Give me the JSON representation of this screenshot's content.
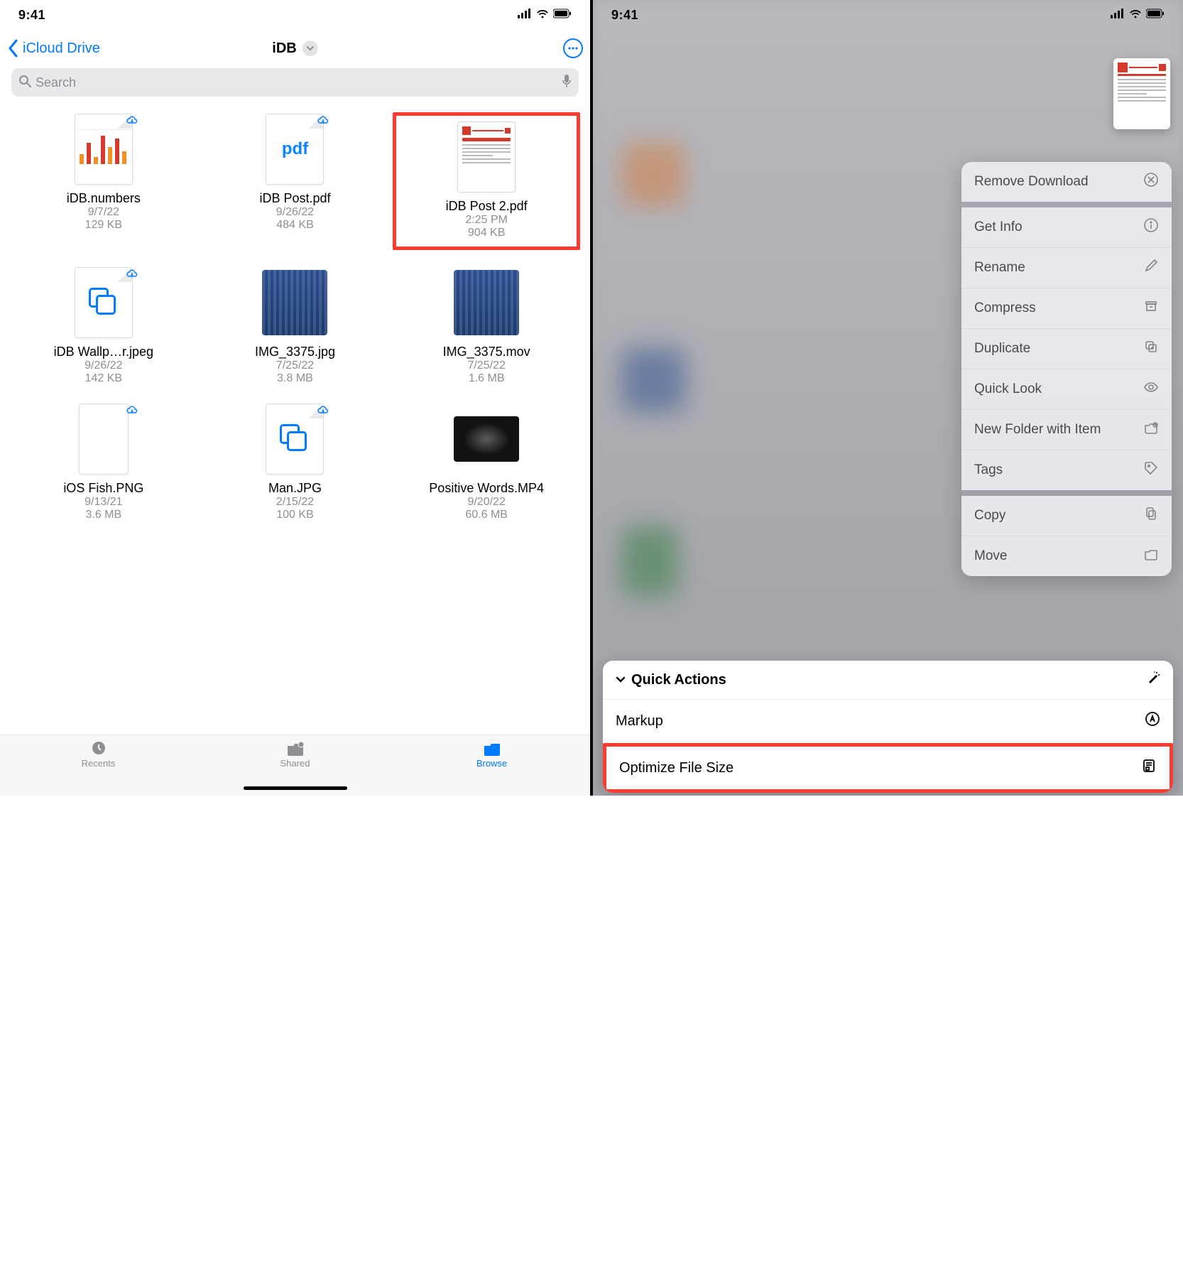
{
  "statusbar": {
    "time": "9:41"
  },
  "nav": {
    "back_label": "iCloud Drive",
    "title": "iDB"
  },
  "search": {
    "placeholder": "Search"
  },
  "files": [
    {
      "name": "iDB.numbers",
      "date": "9/7/22",
      "size": "129 KB",
      "thumb": "numbers",
      "cloud": true
    },
    {
      "name": "iDB Post.pdf",
      "date": "9/26/22",
      "size": "484 KB",
      "thumb": "pdf",
      "cloud": true
    },
    {
      "name": "iDB Post 2.pdf",
      "date": "2:25 PM",
      "size": "904 KB",
      "thumb": "doc",
      "highlight": true
    },
    {
      "name": "iDB Wallp…r.jpeg",
      "date": "9/26/22",
      "size": "142 KB",
      "thumb": "copies",
      "cloud": true
    },
    {
      "name": "IMG_3375.jpg",
      "date": "7/25/22",
      "size": "3.8 MB",
      "thumb": "curtain"
    },
    {
      "name": "IMG_3375.mov",
      "date": "7/25/22",
      "size": "1.6 MB",
      "thumb": "curtain"
    },
    {
      "name": "iOS Fish.PNG",
      "date": "9/13/21",
      "size": "3.6 MB",
      "thumb": "fish",
      "cloud": true
    },
    {
      "name": "Man.JPG",
      "date": "2/15/22",
      "size": "100 KB",
      "thumb": "copies",
      "cloud": true
    },
    {
      "name": "Positive Words.MP4",
      "date": "9/20/22",
      "size": "60.6 MB",
      "thumb": "video"
    }
  ],
  "tabs": {
    "recents": "Recents",
    "shared": "Shared",
    "browse": "Browse"
  },
  "context_menu": {
    "remove_download": "Remove Download",
    "get_info": "Get Info",
    "rename": "Rename",
    "compress": "Compress",
    "duplicate": "Duplicate",
    "quick_look": "Quick Look",
    "new_folder": "New Folder with Item",
    "tags": "Tags",
    "copy": "Copy",
    "move": "Move"
  },
  "quick_actions": {
    "header": "Quick Actions",
    "markup": "Markup",
    "optimize": "Optimize File Size"
  }
}
